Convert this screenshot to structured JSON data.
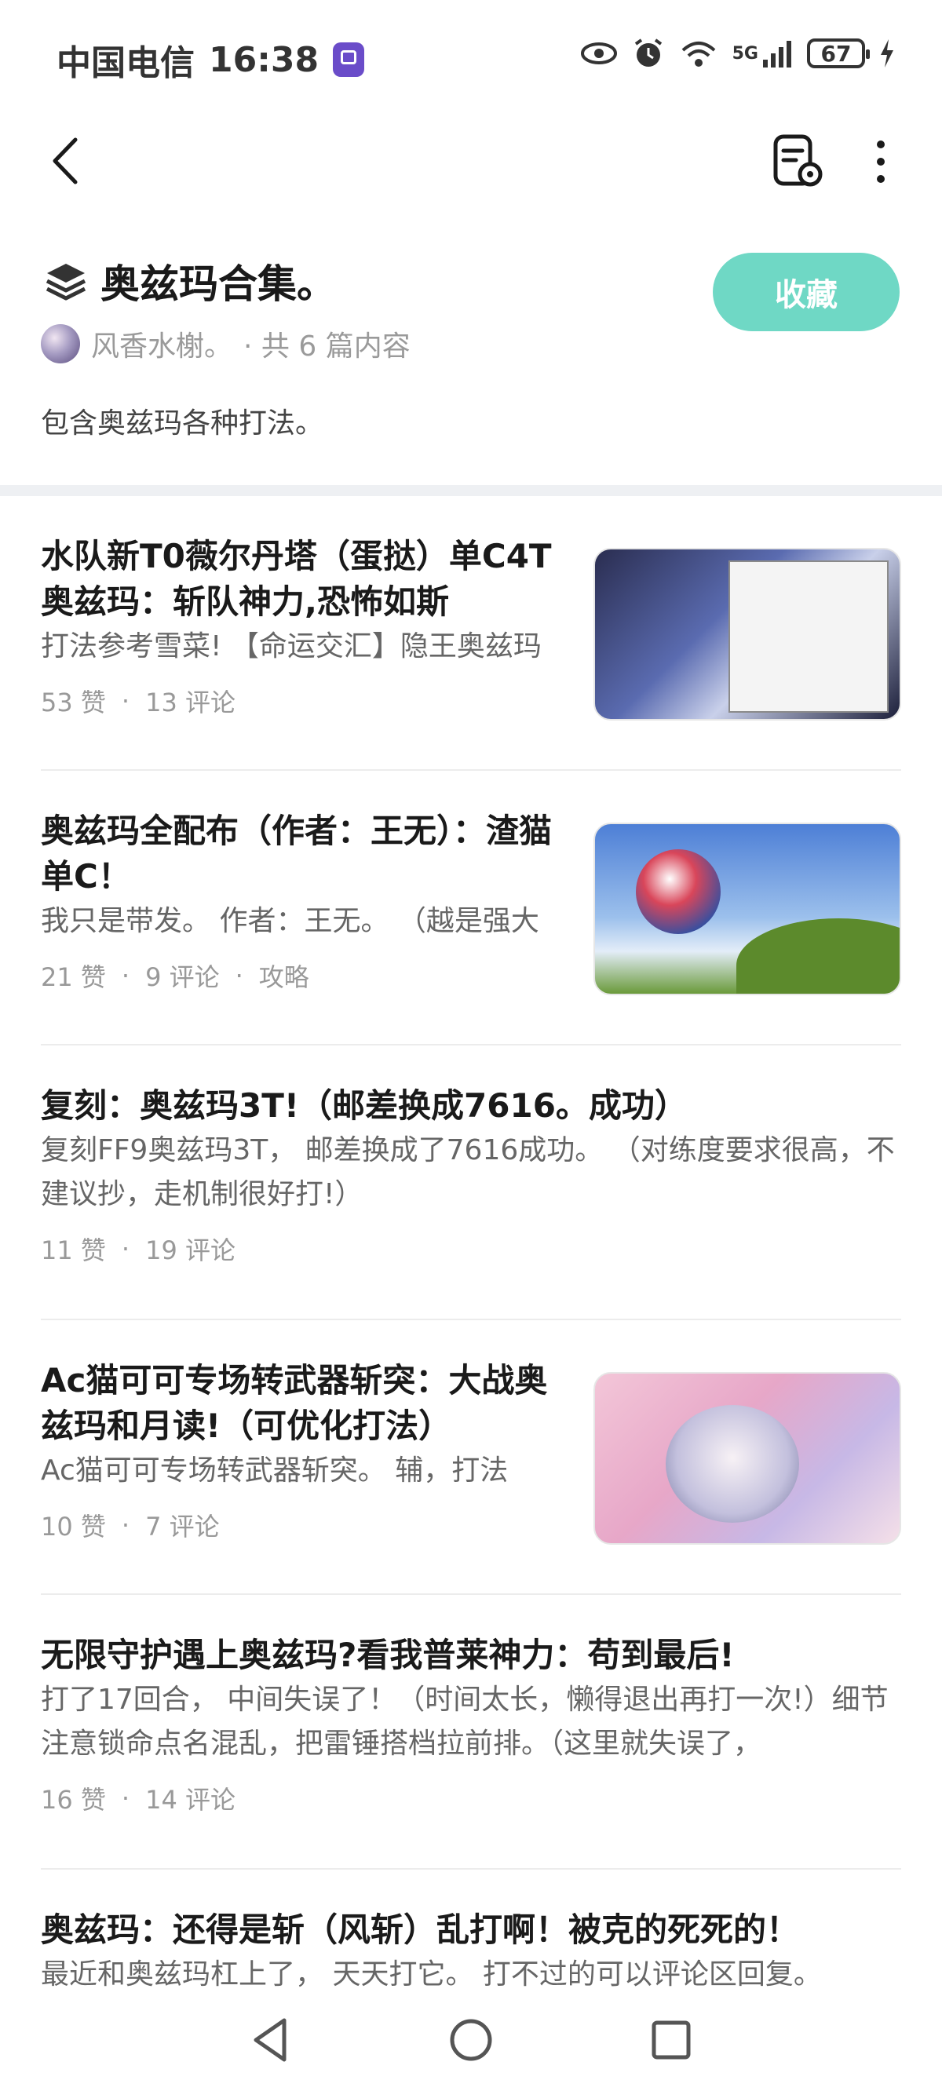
{
  "status_bar": {
    "carrier": "中国电信",
    "time": "16:38",
    "network": "5G",
    "battery": "67"
  },
  "toolbar": {
    "back_icon": "chevron-left-icon",
    "manage_icon": "document-settings-icon",
    "more_icon": "more-vertical-icon"
  },
  "collection": {
    "title": "奥兹玛合集。",
    "icon": "layers-icon",
    "favorite_label": "收藏",
    "author": "风香水榭。",
    "count_text": "· 共 6 篇内容",
    "description": "包含奥兹玛各种打法。",
    "accent_color": "#6fd8c5"
  },
  "articles": [
    {
      "title": "水队新T0薇尔丹塔（蛋挞）单C4T奥兹玛：斩队神力,恐怖如斯",
      "summary": "打法参考雪菜! 【命运交汇】隐王奥兹玛",
      "likes": "53 赞",
      "comments": "13 评论",
      "tag": ""
    },
    {
      "title": "奥兹玛全配布（作者：王无）：渣猫单C！",
      "summary": "我只是带发。 作者：王无。 （越是强大",
      "likes": "21 赞",
      "comments": "9 评论",
      "tag": "攻略"
    },
    {
      "title": "复刻：奥兹玛3T!（邮差换成7616。成功）",
      "summary": "复刻FF9奥兹玛3T， 邮差换成了7616成功。 （对练度要求很高，不建议抄，走机制很好打!）",
      "likes": "11 赞",
      "comments": "19 评论",
      "tag": ""
    },
    {
      "title": "Ac猫可可专场转武器斩突：大战奥兹玛和月读!（可优化打法）",
      "summary": "Ac猫可可专场转武器斩突。 辅，打法",
      "likes": "10 赞",
      "comments": "7 评论",
      "tag": ""
    },
    {
      "title": "无限守护遇上奥兹玛?看我普莱神力：苟到最后!",
      "summary": "打了17回合， 中间失误了！（时间太长，懒得退出再打一次!）细节注意锁命点名混乱，把雷锤搭档拉前排。（这里就失误了，",
      "likes": "16 赞",
      "comments": "14 评论",
      "tag": ""
    },
    {
      "title": "奥兹玛：还得是斩（风斩）乱打啊！被克的死死的！",
      "summary": "最近和奥兹玛杠上了， 天天打它。 打不过的可以评论区回复。",
      "likes": "",
      "comments": "",
      "tag": ""
    }
  ],
  "nav_bar": {
    "back_icon": "triangle-back-icon",
    "home_icon": "circle-home-icon",
    "recents_icon": "square-recents-icon"
  }
}
